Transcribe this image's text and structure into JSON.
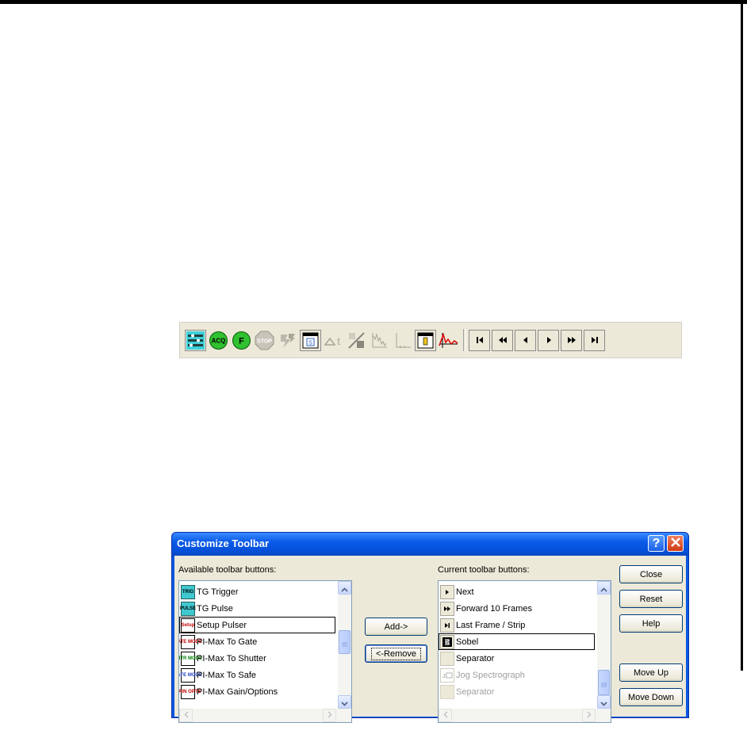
{
  "toolbar": {
    "buttons": [
      {
        "icon": "setup-acquisition-icon"
      },
      {
        "icon": "acquire-icon",
        "label": "ACQ"
      },
      {
        "icon": "focus-icon",
        "label": "F"
      },
      {
        "icon": "stop-icon",
        "label": "STOP"
      },
      {
        "icon": "run-sequence-icon"
      },
      {
        "icon": "display-layout-icon"
      },
      {
        "icon": "delta-time-icon"
      },
      {
        "icon": "scaling-icon"
      },
      {
        "icon": "graph-icon"
      },
      {
        "icon": "axis-icon"
      },
      {
        "icon": "roi-icon"
      },
      {
        "icon": "spectrum-icon"
      },
      {
        "icon": "first-frame-icon"
      },
      {
        "icon": "back-10-frames-icon"
      },
      {
        "icon": "previous-frame-icon"
      },
      {
        "icon": "next-frame-icon"
      },
      {
        "icon": "forward-10-frames-icon"
      },
      {
        "icon": "last-frame-icon"
      }
    ]
  },
  "dialog": {
    "title": "Customize Toolbar",
    "available_label": "Available toolbar buttons:",
    "current_label": "Current toolbar buttons:",
    "available_items": [
      {
        "label": "TG Trigger",
        "icon": "tg-trigger-icon",
        "icon_text": "TRIG"
      },
      {
        "label": "TG Pulse",
        "icon": "tg-pulse-icon",
        "icon_text": "PULSE"
      },
      {
        "label": "Setup Pulser",
        "icon": "setup-pulser-icon",
        "icon_text": "Setup"
      },
      {
        "label": "PI-Max To Gate",
        "icon": "gate-mode-icon",
        "icon_text": "GATE MODE"
      },
      {
        "label": "PI-Max To Shutter",
        "icon": "shutter-mode-icon",
        "icon_text": "SHTR MODE"
      },
      {
        "label": "PI-Max To Safe",
        "icon": "safe-mode-icon",
        "icon_text": "SAFE MODE"
      },
      {
        "label": "PI-Max Gain/Options",
        "icon": "gain-options-icon",
        "icon_text": "GAIN OPTS"
      }
    ],
    "current_items": [
      {
        "label": "Next",
        "icon": "next-frame-icon"
      },
      {
        "label": "Forward 10 Frames",
        "icon": "forward-10-frames-icon"
      },
      {
        "label": "Last Frame / Strip",
        "icon": "last-frame-icon"
      },
      {
        "label": "Sobel",
        "icon": "sobel-icon"
      },
      {
        "label": "Separator",
        "icon": "separator-icon"
      },
      {
        "label": "Jog Spectrograph",
        "icon": "jog-spectrograph-icon"
      },
      {
        "label": "Separator",
        "icon": "separator-icon"
      }
    ],
    "buttons": {
      "add": "Add->",
      "remove": "<-Remove",
      "close": "Close",
      "reset": "Reset",
      "help": "Help",
      "move_up": "Move Up",
      "move_down": "Move Down"
    },
    "selected_available": "Setup Pulser",
    "selected_current": "Sobel"
  }
}
